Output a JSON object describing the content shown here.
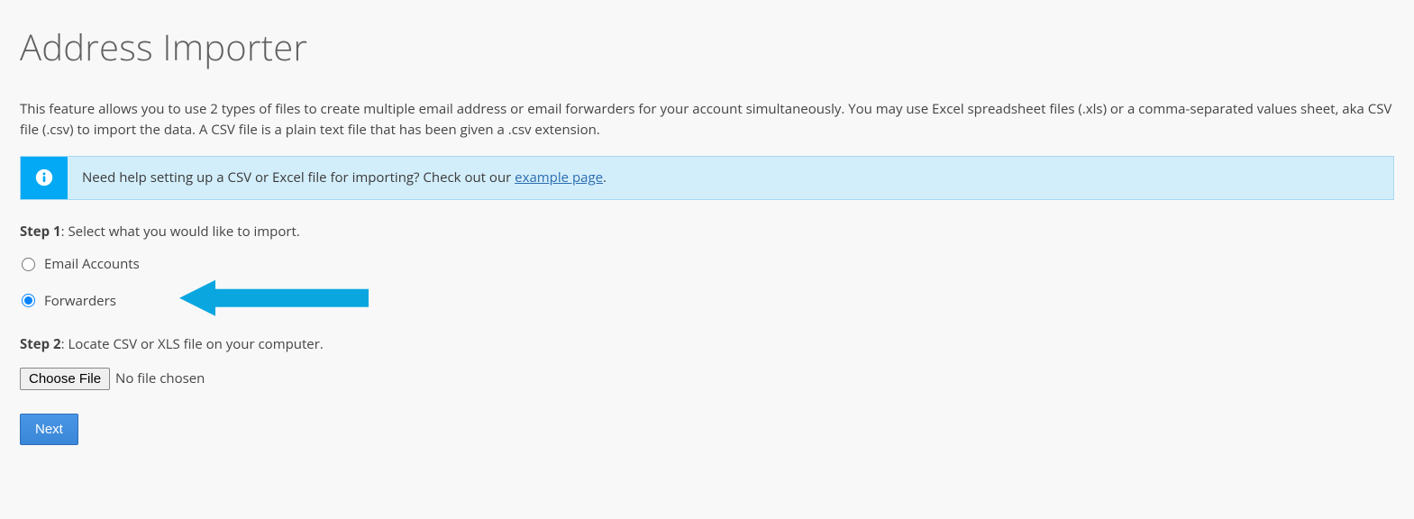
{
  "page": {
    "title": "Address Importer",
    "description": "This feature allows you to use 2 types of files to create multiple email address or email forwarders for your account simultaneously. You may use Excel spreadsheet files (.xls) or a comma-separated values sheet, aka CSV file (.csv) to import the data. A CSV file is a plain text file that has been given a .csv extension."
  },
  "info": {
    "text_before_link": "Need help setting up a CSV or Excel file for importing? Check out our ",
    "link_text": "example page",
    "text_after_link": "."
  },
  "step1": {
    "label": "Step 1",
    "text": ": Select what you would like to import.",
    "options": {
      "email_accounts": "Email Accounts",
      "forwarders": "Forwarders"
    }
  },
  "step2": {
    "label": "Step 2",
    "text": ": Locate CSV or XLS file on your computer.",
    "choose_button": "Choose File",
    "file_status": "No file chosen"
  },
  "buttons": {
    "next": "Next"
  }
}
